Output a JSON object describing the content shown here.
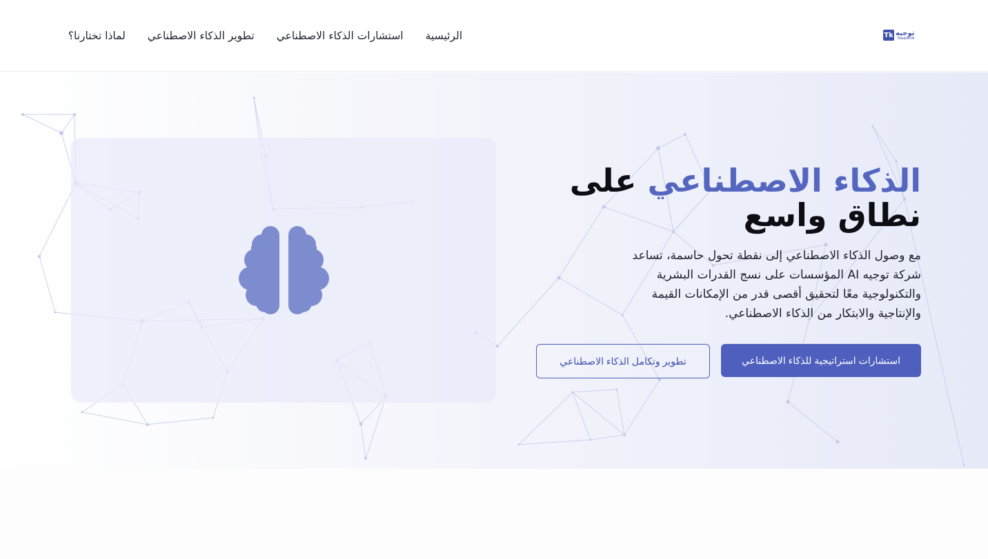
{
  "brand": {
    "logo_mark": "Tk",
    "logo_arabic": "توجيه",
    "logo_english": "TawjeehAI"
  },
  "nav": {
    "items": [
      {
        "label": "الرئيسية"
      },
      {
        "label": "استشارات الذكاء الاصطناعي"
      },
      {
        "label": "تطوير الذكاء الاصطناعي"
      },
      {
        "label": "لماذا تختارنا؟"
      }
    ]
  },
  "hero": {
    "title_accent": "الذكاء الاصطناعي",
    "title_rest": "على نطاق واسع",
    "description": "مع وصول الذكاء الاصطناعي إلى نقطة تحول حاسمة، تساعد شركة توجيه AI المؤسسات على نسج القدرات البشرية والتكنولوجية معًا لتحقيق أقصى قدر من الإمكانات القيمة والإنتاجية والابتكار من الذكاء الاصطناعي.",
    "primary_button": "استشارات استراتيجية للذكاء الاصطناعي",
    "secondary_button": "تطوير وتكامل الذكاء الاصطناعي",
    "illustration_icon": "brain-icon"
  },
  "colors": {
    "accent": "#5566c0",
    "primary_button": "#4e5fbd",
    "brain": "#7d8ccf"
  }
}
